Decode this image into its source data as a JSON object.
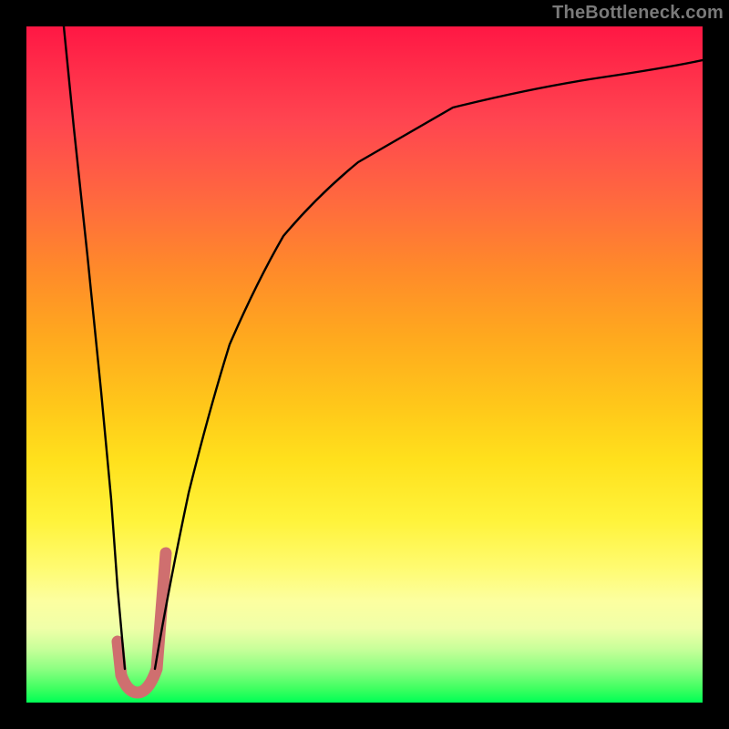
{
  "watermark": {
    "text": "TheBottleneck.com"
  },
  "chart_data": {
    "type": "line",
    "title": "",
    "xlabel": "",
    "ylabel": "",
    "xlim": [
      0,
      100
    ],
    "ylim": [
      0,
      100
    ],
    "grid": false,
    "legend": false,
    "background_gradient": {
      "direction": "top-to-bottom",
      "stops": [
        {
          "pos": 0.0,
          "color": "#ff1744"
        },
        {
          "pos": 0.5,
          "color": "#ffc71a"
        },
        {
          "pos": 0.85,
          "color": "#fcffa0"
        },
        {
          "pos": 1.0,
          "color": "#00ff55"
        }
      ]
    },
    "series": [
      {
        "name": "left-steep-drop",
        "color": "#000000",
        "width": 2,
        "x": [
          5.5,
          7.0,
          9.0,
          11.0,
          12.5,
          13.5,
          14.5
        ],
        "values": [
          100,
          85,
          66,
          46,
          30,
          17,
          5
        ]
      },
      {
        "name": "right-rising-curve",
        "color": "#000000",
        "width": 2,
        "x": [
          19,
          21,
          24,
          27,
          30,
          34,
          38,
          43,
          49,
          56,
          65,
          75,
          86,
          95,
          100
        ],
        "values": [
          5,
          17,
          31,
          43,
          53,
          62,
          69,
          75,
          80,
          84,
          87,
          90,
          92.5,
          94,
          95
        ]
      },
      {
        "name": "j-marker",
        "color": "#cf6f6f",
        "width": 13,
        "cap": "round",
        "x": [
          13.5,
          14.0,
          15.0,
          16.5,
          18.0,
          19.3,
          20.1,
          20.6
        ],
        "values": [
          9,
          4,
          1.5,
          1.2,
          1.8,
          5,
          12,
          22
        ]
      }
    ]
  }
}
